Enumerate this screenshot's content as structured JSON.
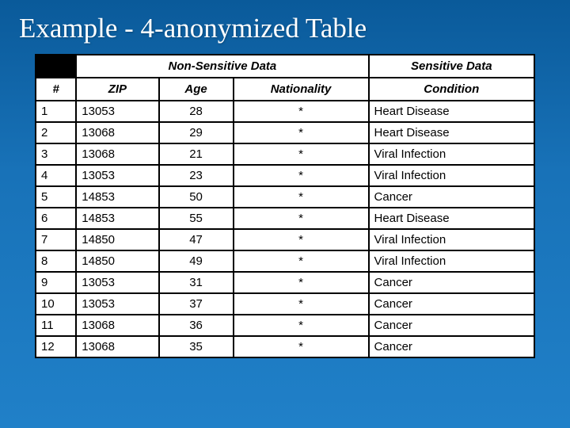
{
  "title": "Example - 4-anonymized Table",
  "group_headers": {
    "non_sensitive": "Non-Sensitive Data",
    "sensitive": "Sensitive Data"
  },
  "columns": [
    "#",
    "ZIP",
    "Age",
    "Nationality",
    "Condition"
  ],
  "rows": [
    {
      "idx": "1",
      "zip": "13053",
      "age": "28",
      "nat": "*",
      "cond": "Heart Disease"
    },
    {
      "idx": "2",
      "zip": "13068",
      "age": "29",
      "nat": "*",
      "cond": "Heart Disease"
    },
    {
      "idx": "3",
      "zip": "13068",
      "age": "21",
      "nat": "*",
      "cond": "Viral Infection"
    },
    {
      "idx": "4",
      "zip": "13053",
      "age": "23",
      "nat": "*",
      "cond": "Viral Infection"
    },
    {
      "idx": "5",
      "zip": "14853",
      "age": "50",
      "nat": "*",
      "cond": "Cancer"
    },
    {
      "idx": "6",
      "zip": "14853",
      "age": "55",
      "nat": "*",
      "cond": "Heart Disease"
    },
    {
      "idx": "7",
      "zip": "14850",
      "age": "47",
      "nat": "*",
      "cond": "Viral Infection"
    },
    {
      "idx": "8",
      "zip": "14850",
      "age": "49",
      "nat": "*",
      "cond": "Viral Infection"
    },
    {
      "idx": "9",
      "zip": "13053",
      "age": "31",
      "nat": "*",
      "cond": "Cancer"
    },
    {
      "idx": "10",
      "zip": "13053",
      "age": "37",
      "nat": "*",
      "cond": "Cancer"
    },
    {
      "idx": "11",
      "zip": "13068",
      "age": "36",
      "nat": "*",
      "cond": "Cancer"
    },
    {
      "idx": "12",
      "zip": "13068",
      "age": "35",
      "nat": "*",
      "cond": "Cancer"
    }
  ],
  "chart_data": {
    "type": "table",
    "title": "Example - 4-anonymized Table",
    "columns": [
      "#",
      "ZIP",
      "Age",
      "Nationality",
      "Condition"
    ],
    "column_groups": {
      "Non-Sensitive Data": [
        "ZIP",
        "Age",
        "Nationality"
      ],
      "Sensitive Data": [
        "Condition"
      ]
    },
    "rows": [
      [
        1,
        13053,
        28,
        "*",
        "Heart Disease"
      ],
      [
        2,
        13068,
        29,
        "*",
        "Heart Disease"
      ],
      [
        3,
        13068,
        21,
        "*",
        "Viral Infection"
      ],
      [
        4,
        13053,
        23,
        "*",
        "Viral Infection"
      ],
      [
        5,
        14853,
        50,
        "*",
        "Cancer"
      ],
      [
        6,
        14853,
        55,
        "*",
        "Heart Disease"
      ],
      [
        7,
        14850,
        47,
        "*",
        "Viral Infection"
      ],
      [
        8,
        14850,
        49,
        "*",
        "Viral Infection"
      ],
      [
        9,
        13053,
        31,
        "*",
        "Cancer"
      ],
      [
        10,
        13053,
        37,
        "*",
        "Cancer"
      ],
      [
        11,
        13068,
        36,
        "*",
        "Cancer"
      ],
      [
        12,
        13068,
        35,
        "*",
        "Cancer"
      ]
    ]
  }
}
